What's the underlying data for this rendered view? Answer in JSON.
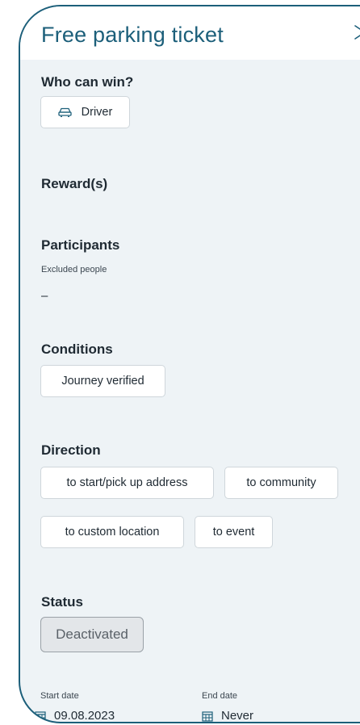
{
  "panel": {
    "title": "Free parking ticket"
  },
  "who_can_win": {
    "heading": "Who can win?",
    "chip": {
      "label": "Driver",
      "icon": "car-icon"
    }
  },
  "rewards": {
    "heading": "Reward(s)"
  },
  "participants": {
    "heading": "Participants",
    "excluded_label": "Excluded people",
    "excluded_value": "–"
  },
  "conditions": {
    "heading": "Conditions",
    "chips": [
      "Journey verified"
    ]
  },
  "direction": {
    "heading": "Direction",
    "chips": [
      "to start/pick up address",
      "to community",
      "to custom location",
      "to event"
    ]
  },
  "status": {
    "heading": "Status",
    "value": "Deactivated"
  },
  "dates": {
    "start_label": "Start date",
    "start_value": "09.08.2023",
    "end_label": "End date",
    "end_value": "Never",
    "icon": "calendar-icon"
  },
  "colors": {
    "accent": "#1c5f7a",
    "panel_bg": "#eef3f6",
    "chip_border": "#cfd6db",
    "status_bg": "#e3e6e9"
  }
}
